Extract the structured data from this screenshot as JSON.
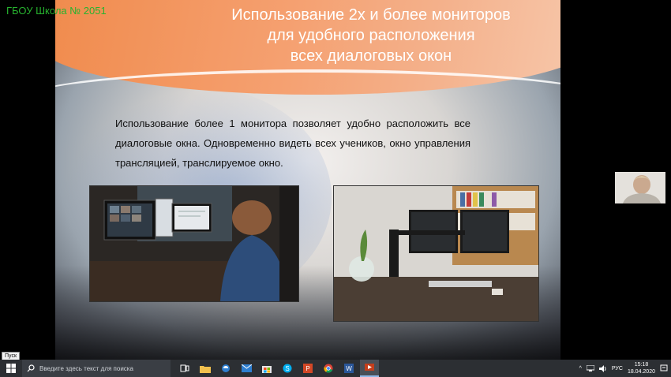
{
  "watermark": "ГБОУ Школа № 2051",
  "slide": {
    "title_lines": [
      "Использование 2х и более мониторов",
      "для удобного расположения",
      "всех диалоговых окон"
    ],
    "body": "Использование более 1 монитора позволяет удобно расположить все диалоговые окна. Одновременно видеть всех учеников, окно управления трансляцией, транслируемое окно.",
    "photos": [
      {
        "name": "photo-person-two-monitors",
        "icon": "photo-icon"
      },
      {
        "name": "photo-dual-monitor-stand",
        "icon": "photo-icon"
      }
    ]
  },
  "tooltip": "Пуск",
  "taskbar": {
    "search_placeholder": "Введите здесь текст для поиска",
    "apps": [
      {
        "name": "task-view-icon"
      },
      {
        "name": "file-explorer-icon"
      },
      {
        "name": "edge-icon"
      },
      {
        "name": "mail-icon"
      },
      {
        "name": "store-icon"
      },
      {
        "name": "skype-icon"
      },
      {
        "name": "powerpoint-icon"
      },
      {
        "name": "chrome-icon"
      },
      {
        "name": "word-icon"
      },
      {
        "name": "slideshow-icon"
      }
    ],
    "language": "РУС",
    "time": "15:18",
    "date": "18.04.2020"
  },
  "colors": {
    "accent_orange": "#f08a4b",
    "taskbar": "#2c2f33",
    "watermark": "#27b32f"
  }
}
